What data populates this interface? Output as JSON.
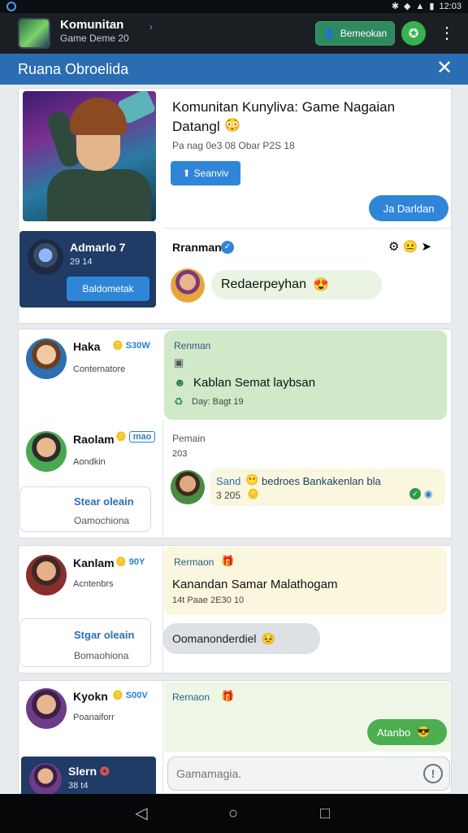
{
  "status_bar": {
    "time": "12:03",
    "icons": [
      "bluetooth-icon",
      "wifi-icon",
      "signal-icon",
      "battery-icon"
    ]
  },
  "app_bar": {
    "title": "Komunitan",
    "subtitle": "Game Deme 20",
    "join_label": "Bemeokan",
    "colors": {
      "bg": "#1b1f24",
      "join": "#2f8a5e",
      "game": "#37b24d"
    }
  },
  "panel": {
    "title": "Ruana Obroelida",
    "color": "#2a6db3"
  },
  "post": {
    "title": "Komunitan Kunyliva: Game Nagaian Datangl",
    "meta": "Pa nag 0e3 08 Obar P2S 18",
    "action_label": "Seanviv",
    "reply_bubble": "Ja Darldan"
  },
  "profile_card": {
    "name": "Admarlo 7",
    "sub": "29 14",
    "button": "Baldometak"
  },
  "reply_card": {
    "name": "Rranman",
    "message": "Redaerpeyhan"
  },
  "threads": [
    {
      "name": "Haka",
      "tag": "S30W",
      "role": "Conternatore",
      "panel_label": "Renman",
      "message": "Kablan Semat laybsan",
      "time": "Day: Bagt 19"
    },
    {
      "name": "Raolam",
      "tag": "mao",
      "role": "Aondkin",
      "side_title": "Stear oleain",
      "side_sub": "Oamochiona",
      "panel_label": "Pemain",
      "panel_sub": "203",
      "msg_user": "Sand",
      "message": "bedroes Bankakenlan bla",
      "msg_time": "3 205"
    },
    {
      "name": "Kanlam",
      "tag": "90Y",
      "role": "Acntenbrs",
      "side_title": "Stgar oleain",
      "side_sub": "Bomaohiona",
      "panel_label": "Rermaon",
      "message": "Kanandan Samar Malathogam",
      "time": "14t Paae 2E30 10",
      "reply": "Oomanonderdiel"
    },
    {
      "name": "Kyokn",
      "tag": "S00V",
      "role": "Poanaiforr",
      "panel_label": "Rernaon",
      "bubble": "Atanbo"
    }
  ],
  "bottom_card": {
    "name": "Slern",
    "sub": "38 t4"
  },
  "input": {
    "placeholder": "Gamamagia."
  }
}
